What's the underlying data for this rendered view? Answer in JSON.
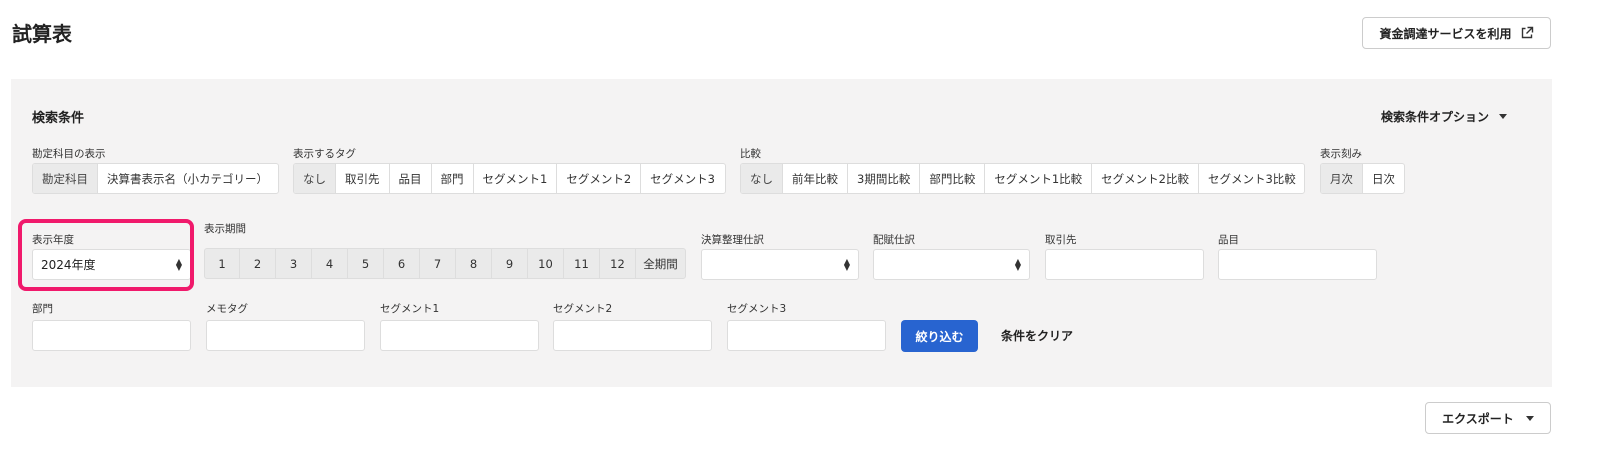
{
  "header": {
    "title": "試算表",
    "funding_button": "資金調達サービスを利用"
  },
  "search": {
    "title": "検索条件",
    "options_label": "検索条件オプション",
    "account_display": {
      "label": "勘定科目の表示",
      "options": [
        "勘定科目",
        "決算書表示名（小カテゴリー）"
      ],
      "selected": "勘定科目"
    },
    "tags": {
      "label": "表示するタグ",
      "options": [
        "なし",
        "取引先",
        "品目",
        "部門",
        "セグメント1",
        "セグメント2",
        "セグメント3"
      ],
      "selected": "なし"
    },
    "compare": {
      "label": "比較",
      "options": [
        "なし",
        "前年比較",
        "3期間比較",
        "部門比較",
        "セグメント1比較",
        "セグメント2比較",
        "セグメント3比較"
      ],
      "selected": "なし"
    },
    "granularity": {
      "label": "表示刻み",
      "options": [
        "月次",
        "日次"
      ],
      "selected": "月次"
    },
    "fiscal_year": {
      "label": "表示年度",
      "value": "2024年度"
    },
    "period": {
      "label": "表示期間",
      "options": [
        "1",
        "2",
        "3",
        "4",
        "5",
        "6",
        "7",
        "8",
        "9",
        "10",
        "11",
        "12",
        "全期間"
      ]
    },
    "closing_entries": {
      "label": "決算整理仕訳",
      "value": ""
    },
    "allocation_entries": {
      "label": "配賦仕訳",
      "value": ""
    },
    "partner": {
      "label": "取引先",
      "value": ""
    },
    "item": {
      "label": "品目",
      "value": ""
    },
    "department": {
      "label": "部門",
      "value": ""
    },
    "memo_tag": {
      "label": "メモタグ",
      "value": ""
    },
    "segment1": {
      "label": "セグメント1",
      "value": ""
    },
    "segment2": {
      "label": "セグメント2",
      "value": ""
    },
    "segment3": {
      "label": "セグメント3",
      "value": ""
    },
    "filter_button": "絞り込む",
    "clear_button": "条件をクリア"
  },
  "export_button": "エクスポート",
  "colors": {
    "panel_bg": "#f4f3f3",
    "primary": "#2864d0",
    "highlight": "#f0196b"
  }
}
